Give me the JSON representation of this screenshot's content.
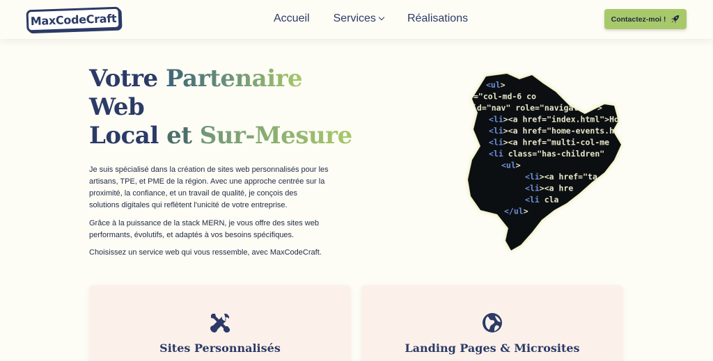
{
  "header": {
    "logo_text": "MaxCodeCraft",
    "nav": [
      {
        "label": "Accueil"
      },
      {
        "label": "Services",
        "icon": "chevron-down-icon"
      },
      {
        "label": "Réalisations"
      }
    ],
    "cta_label": "Contactez-moi !",
    "cta_icon": "rocket-icon",
    "cta_color": "#a8c96a"
  },
  "hero": {
    "title_part1": "Votre ",
    "title_part2": "Partenaire",
    "title_line2": "Web",
    "title_part3": "Local",
    "title_part4": " et ",
    "title_part5": "Sur-Mesure",
    "paragraphs": [
      "Je suis spécialisé dans la création de sites web personnalisés pour les artisans, TPE, et PME de la région. Avec une approche centrée sur la proximité, la confiance, et un travail de qualité, je conçois des solutions digitales qui reflètent l'unicité de votre entreprise.",
      "Grâce à la puissance de la stack MERN, je vous offre des sites web performants, évolutifs, et adaptés à vos besoins spécifiques.",
      "Choisissez un service web qui vous ressemble, avec MaxCodeCraft."
    ],
    "map_code_lines": [
      "<ul>",
      "=\"col-md-6 co",
      "id=\"nav\" role=\"navigation\">",
      "<li><a href=\"index.html\">Hom",
      "<li><a href=\"home-events.htm",
      "<li><a href=\"multi-col-me",
      "<li class=\"has-children\"",
      "<ul>",
      "<li><a href=\"ta",
      "<li><a hre",
      "<li cla",
      "</ul>"
    ]
  },
  "cards": [
    {
      "title": "Sites Personnalisés",
      "icon": "tools-icon"
    },
    {
      "title": "Landing Pages & Microsites",
      "icon": "globe-icon"
    }
  ],
  "colors": {
    "primary": "#2b3a66",
    "accent_green": "#a8c96a",
    "background": "#fdfcf5",
    "card_bg": "#fbf1ea"
  }
}
